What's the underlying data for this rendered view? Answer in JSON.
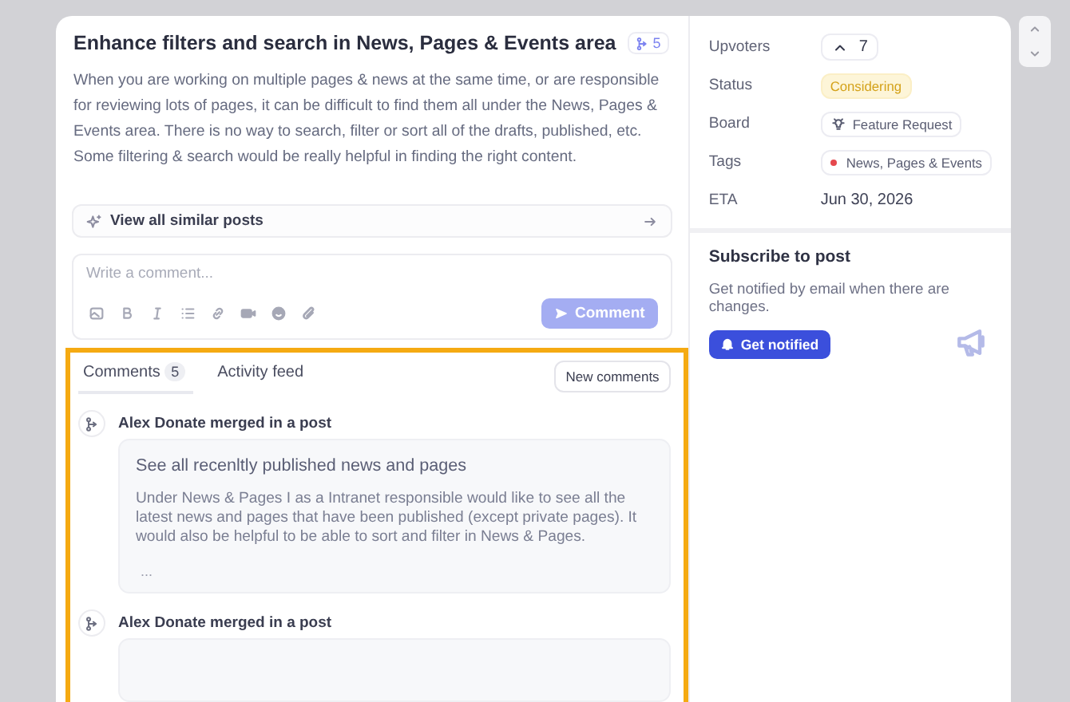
{
  "post": {
    "title": "Enhance filters and search in News, Pages & Events area",
    "merge_count": "5",
    "description": "When you are working on multiple pages & news at the same time, or are responsible for reviewing lots of pages, it can be difficult to find them all under the News, Pages & Events area. There is no way to search, filter or sort all of the drafts, published, etc. Some filtering & search would be really helpful in finding the right content."
  },
  "similar_posts": {
    "label": "View all similar posts"
  },
  "comment_editor": {
    "placeholder": "Write a comment...",
    "submit": {
      "label": "Comment",
      "disabled": true
    }
  },
  "activity": {
    "highlighted": true,
    "tabs": [
      {
        "label": "Comments",
        "count": "5",
        "selected": true
      },
      {
        "label": "Activity feed",
        "selected": false
      }
    ],
    "new_comments": "New comments",
    "events": [
      {
        "actor_line": "Alex Donate merged in a post",
        "post_title": "See all recenltly published news and pages",
        "post_body": "Under News & Pages I as a Intranet responsible would like to see all the latest news and pages that have been published (except private pages). It would also be helpful to be able to sort and filter in News & Pages.",
        "more": "..."
      },
      {
        "actor_line": "Alex Donate merged in a post"
      }
    ]
  },
  "details": [
    {
      "kind": "upvote",
      "label": "Upvoters",
      "value": "7"
    },
    {
      "kind": "status",
      "label": "Status",
      "value": "Considering"
    },
    {
      "kind": "board",
      "label": "Board",
      "value": "Feature Request"
    },
    {
      "kind": "tag",
      "label": "Tags",
      "value": "News, Pages & Events",
      "color": "#e5484d"
    },
    {
      "kind": "text",
      "label": "ETA",
      "value": "Jun 30, 2026"
    }
  ],
  "subscribe": {
    "title": "Subscribe to post",
    "text": "Get notified by email when there are changes.",
    "button": "Get notified"
  }
}
